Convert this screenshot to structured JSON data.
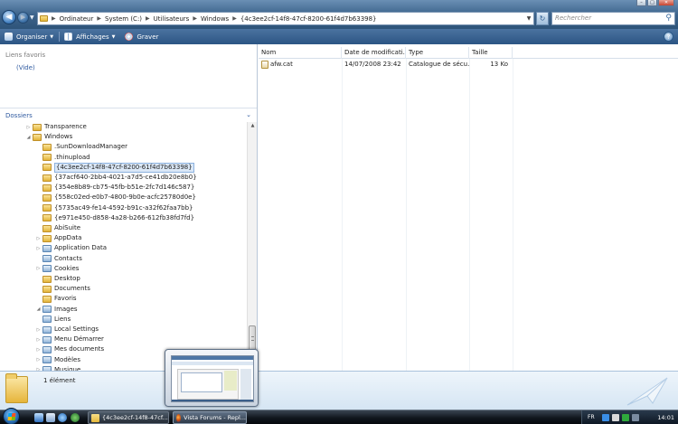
{
  "address": {
    "crumbs": [
      "Ordinateur",
      "System (C:)",
      "Utilisateurs",
      "Windows",
      "{4c3ee2cf-14f8-47cf-8200-61f4d7b63398}"
    ],
    "search_placeholder": "Rechercher"
  },
  "toolbar": {
    "organize": "Organiser",
    "views": "Affichages",
    "burn": "Graver"
  },
  "left": {
    "favorites_heading": "Liens favoris",
    "favorites_empty": "(Vide)",
    "folders_heading": "Dossiers",
    "tree": [
      {
        "label": "Transparence",
        "level": 0,
        "expander": "collapsed",
        "icon": "folder"
      },
      {
        "label": "Windows",
        "level": 0,
        "expander": "expanded",
        "icon": "folder"
      },
      {
        "label": ".SunDownloadManager",
        "level": 1,
        "expander": "none",
        "icon": "folder"
      },
      {
        "label": ".thinupload",
        "level": 1,
        "expander": "none",
        "icon": "folder"
      },
      {
        "label": "{4c3ee2cf-14f8-47cf-8200-61f4d7b63398}",
        "level": 1,
        "expander": "none",
        "icon": "folder",
        "selected": true
      },
      {
        "label": "{37acf640-2bb4-4021-a7d5-ce41db20e8b0}",
        "level": 1,
        "expander": "none",
        "icon": "folder"
      },
      {
        "label": "{354e8b89-cb75-45fb-b51e-2fc7d146c587}",
        "level": 1,
        "expander": "none",
        "icon": "folder"
      },
      {
        "label": "{558c02ed-e0b7-4800-9b0e-acfc25780d0e}",
        "level": 1,
        "expander": "none",
        "icon": "folder"
      },
      {
        "label": "{5735ac49-fe14-4592-b91c-a32f62faa7bb}",
        "level": 1,
        "expander": "none",
        "icon": "folder"
      },
      {
        "label": "{e971e450-d858-4a28-b266-612fb38fd7fd}",
        "level": 1,
        "expander": "none",
        "icon": "folder"
      },
      {
        "label": "AbiSuite",
        "level": 1,
        "expander": "none",
        "icon": "folder"
      },
      {
        "label": "AppData",
        "level": 1,
        "expander": "collapsed",
        "icon": "folder"
      },
      {
        "label": "Application Data",
        "level": 1,
        "expander": "collapsed",
        "icon": "special"
      },
      {
        "label": "Contacts",
        "level": 1,
        "expander": "none",
        "icon": "special"
      },
      {
        "label": "Cookies",
        "level": 1,
        "expander": "collapsed",
        "icon": "special"
      },
      {
        "label": "Desktop",
        "level": 1,
        "expander": "none",
        "icon": "folder"
      },
      {
        "label": "Documents",
        "level": 1,
        "expander": "none",
        "icon": "folder"
      },
      {
        "label": "Favoris",
        "level": 1,
        "expander": "none",
        "icon": "folder"
      },
      {
        "label": "Images",
        "level": 1,
        "expander": "expanded",
        "icon": "special"
      },
      {
        "label": "Liens",
        "level": 1,
        "expander": "none",
        "icon": "special"
      },
      {
        "label": "Local Settings",
        "level": 1,
        "expander": "collapsed",
        "icon": "special"
      },
      {
        "label": "Menu Démarrer",
        "level": 1,
        "expander": "collapsed",
        "icon": "special"
      },
      {
        "label": "Mes documents",
        "level": 1,
        "expander": "collapsed",
        "icon": "special"
      },
      {
        "label": "Modèles",
        "level": 1,
        "expander": "collapsed",
        "icon": "special"
      },
      {
        "label": "Musique",
        "level": 1,
        "expander": "collapsed",
        "icon": "special"
      }
    ]
  },
  "files": {
    "columns": [
      "Nom",
      "Date de modificati...",
      "Type",
      "Taille"
    ],
    "rows": [
      {
        "name": "afw.cat",
        "date": "14/07/2008 23:42",
        "type": "Catalogue de sécu...",
        "size": "13 Ko"
      }
    ]
  },
  "details": {
    "count": "1 élément"
  },
  "taskbar": {
    "task1": "{4c3ee2cf-14f8-47cf...",
    "task2": "Vista Forums - Repl...",
    "lang": "FR",
    "clock": "14:01"
  },
  "colors": {
    "accent": "#2c5584",
    "link": "#2f5aa0",
    "selection": "#dbe8f7"
  }
}
